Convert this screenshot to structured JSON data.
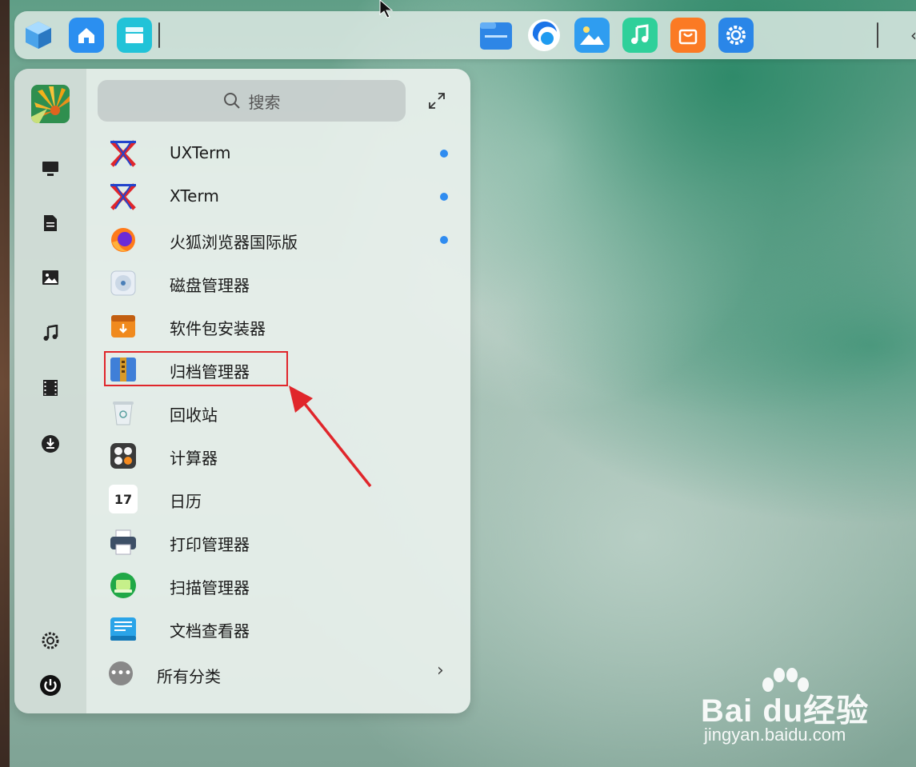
{
  "dock": {
    "left_icons": [
      "launcher-cube-icon",
      "home-icon",
      "multitask-view-icon"
    ],
    "center_icons": [
      "file-manager-icon",
      "browser-icon",
      "image-viewer-icon",
      "music-icon",
      "app-store-icon",
      "settings-gear-icon"
    ],
    "collapse_glyph": "‹"
  },
  "launcher": {
    "sidebar": [
      "computer-icon",
      "document-icon",
      "picture-icon",
      "music-note-icon",
      "video-icon",
      "download-icon"
    ],
    "sidebar_bottom": [
      "settings-icon",
      "power-icon"
    ],
    "search": {
      "placeholder": "搜索"
    },
    "apps": [
      {
        "label": "UXTerm",
        "icon": "uxterm-icon",
        "new": true
      },
      {
        "label": "XTerm",
        "icon": "xterm-icon",
        "new": true
      },
      {
        "label": "火狐浏览器国际版",
        "icon": "firefox-icon",
        "new": true
      },
      {
        "label": "磁盘管理器",
        "icon": "disk-manager-icon",
        "new": false
      },
      {
        "label": "软件包安装器",
        "icon": "package-installer-icon",
        "new": false
      },
      {
        "label": "归档管理器",
        "icon": "archive-manager-icon",
        "new": false
      },
      {
        "label": "回收站",
        "icon": "trash-icon",
        "new": false
      },
      {
        "label": "计算器",
        "icon": "calculator-icon",
        "new": false
      },
      {
        "label": "日历",
        "icon": "calendar-icon",
        "new": false,
        "day": "17"
      },
      {
        "label": "打印管理器",
        "icon": "printer-icon",
        "new": false
      },
      {
        "label": "扫描管理器",
        "icon": "scanner-icon",
        "new": false
      },
      {
        "label": "文档查看器",
        "icon": "document-viewer-icon",
        "new": false
      }
    ],
    "all_categories": {
      "label": "所有分类",
      "glyph": "›"
    }
  },
  "watermark": {
    "brand": "Bai du经验",
    "url": "jingyan.baidu.com"
  },
  "colors": {
    "accent": "#2f8cf0",
    "highlight": "#e0262b"
  }
}
